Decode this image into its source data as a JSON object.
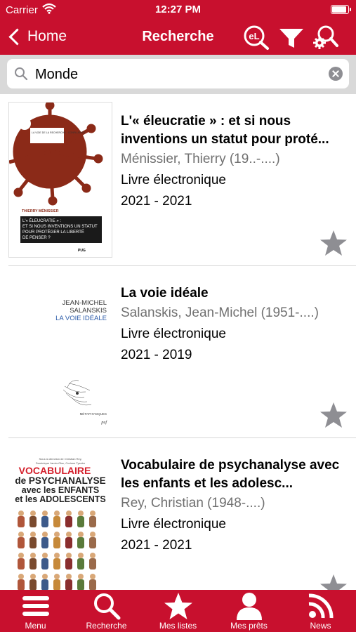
{
  "status_bar": {
    "carrier": "Carrier",
    "time": "12:27 PM"
  },
  "nav": {
    "back_label": "Home",
    "title": "Recherche"
  },
  "search": {
    "value": "Monde"
  },
  "results": [
    {
      "title": "L'« éleucratie » : et si nous inventions un statut pour proté...",
      "author": "Ménissier, Thierry (19..-....)",
      "type": "Livre électronique",
      "date": "2021 - 2021",
      "cover": {
        "series": "LA VOIE DE LA RECHERCHE · CONFLUENCE",
        "author": "THIERRY MÉNISSIER",
        "title_lines": [
          "L'« ÉLEUCRATIE » :",
          "ET SI NOUS INVENTIONS UN STATUT",
          "POUR PROTÉGER LA LIBERTÉ",
          "DE PENSER ?"
        ],
        "publisher": "PUG",
        "virus_color": "#8b2a18"
      }
    },
    {
      "title": "La voie idéale",
      "author": "Salanskis, Jean-Michel (1951-....)",
      "type": "Livre électronique",
      "date": "2021 - 2019",
      "cover": {
        "author_lines": [
          "JEAN-MICHEL",
          "SALANSKIS"
        ],
        "title": "LA VOIE IDÉALE",
        "collection": "MÉTAPHYSIQUES",
        "publisher": "puf"
      }
    },
    {
      "title": "Vocabulaire de psychanalyse avec les enfants et les adolesc...",
      "author": "Rey, Christian (1948-....)",
      "type": "Livre électronique",
      "date": "2021 - 2021",
      "cover": {
        "editors_top": "Sous la direction de Christian Rey,",
        "editors_bottom": "Dominique Jamin-Olsc, Corinne Tyszler",
        "line1": "VOCABULAIRE",
        "line2": "de PSYCHANALYSE",
        "line3": "avec les ENFANTS",
        "line4": "et les ADOLESCENTS"
      }
    }
  ],
  "tabs": [
    {
      "label": "Menu",
      "icon": "menu-icon"
    },
    {
      "label": "Recherche",
      "icon": "search-icon"
    },
    {
      "label": "Mes listes",
      "icon": "star-icon"
    },
    {
      "label": "Mes prêts",
      "icon": "user-icon"
    },
    {
      "label": "News",
      "icon": "rss-icon"
    }
  ],
  "colors": {
    "brand": "#c8102e",
    "star": "#8e8e93",
    "search_bg": "#d9d9d9"
  }
}
